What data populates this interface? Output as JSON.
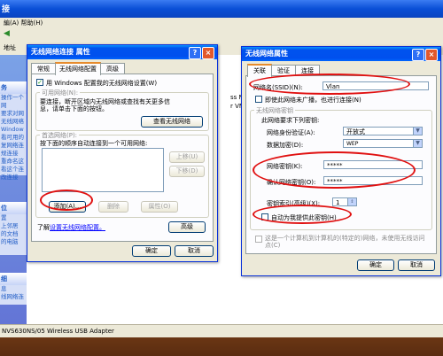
{
  "background_window": {
    "title_fragment": "接",
    "menu_fragment": "編(A)   帮助(H)",
    "address_label": "地址",
    "statusbar_text": "NVS630NS/05 Wireless USB Adapter",
    "left_pane": {
      "section1_items": [
        "操作一个网",
        "要求对网",
        "无线网络",
        "Window",
        "看可用的",
        "复网络连",
        "规连接",
        "重命名这",
        "看这个连",
        "改连接"
      ],
      "section2_items": [
        "置",
        "上邻居",
        "的文档",
        "的电脑"
      ],
      "section3_items": [
        "息",
        "线网络连"
      ]
    },
    "right_pane_fragment": [
      "ss Netw",
      "r VMw"
    ]
  },
  "left_dialog": {
    "title": "无线网络连接 属性",
    "tabs": [
      "常规",
      "无线网络配置",
      "高级"
    ],
    "use_windows_checkbox": "用 Windows 配置我的无线网络设置(W)",
    "available_group": {
      "label": "可用网络(N):",
      "description": "要连接，断开区域内无线网络或查找有关更多信息，请单击下面的按钮。",
      "view_button": "查看无线网络"
    },
    "preferred_group": {
      "label": "首选网络(P):",
      "description": "按下面的顺序自动连接到一个可用网络:",
      "move_up_button": "上移(U)",
      "move_down_button": "下移(D)",
      "add_button": "添加(A)...",
      "remove_button": "删除",
      "properties_button": "属性(O)"
    },
    "learn_link_prefix": "了解",
    "learn_link": "设置无线网络配置。",
    "advanced_button": "高级",
    "ok_button": "确定",
    "cancel_button": "取消"
  },
  "right_dialog": {
    "title": "无线网络属性",
    "tabs": [
      "关联",
      "验证",
      "连接"
    ],
    "ssid_label": "网络名(SSID)(N):",
    "ssid_value": "Vlan",
    "broadcast_checkbox": "即使此网络未广播，也进行连接(N)",
    "key_group": {
      "label": "无线网络密钥",
      "description": "此网络要求下列密钥:",
      "auth_label": "网络身份验证(A):",
      "auth_value": "开放式",
      "encryption_label": "数据加密(D):",
      "encryption_value": "WEP",
      "key_label": "网络密钥(K):",
      "key_value": "*****",
      "confirm_label": "确认网络密钥(O):",
      "confirm_value": "*****",
      "index_label": "密钥索引(高级)(X):",
      "index_value": "1",
      "auto_key_checkbox": "自动为我提供此密钥(H)"
    },
    "adhoc_checkbox": "这是一个计算机到计算机的(特定的)网络，未使用无线访问点(C)",
    "ok_button": "确定",
    "cancel_button": "取消"
  },
  "colors": {
    "xp_blue": "#0053ee",
    "dialog_face": "#ece9d8",
    "highlight_oval": "#e01010"
  }
}
